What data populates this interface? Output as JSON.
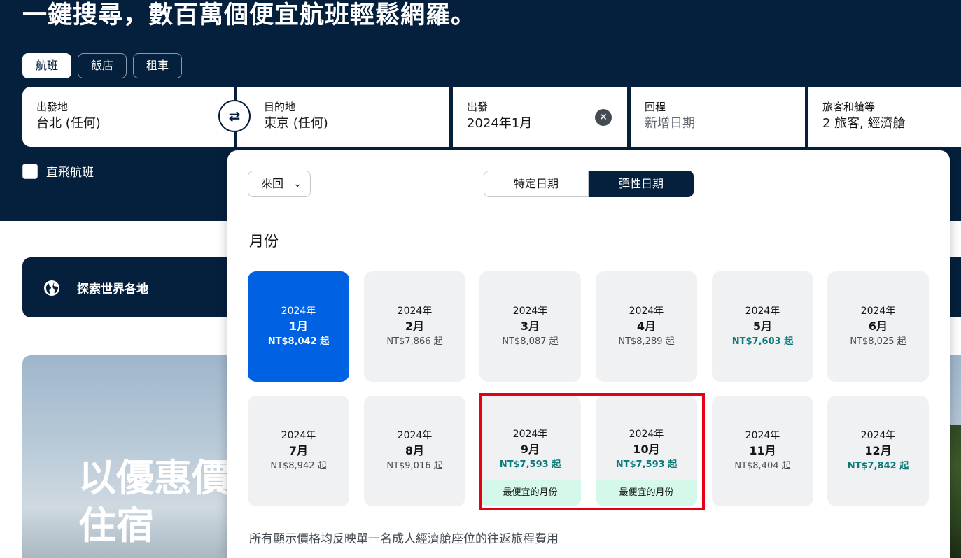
{
  "headline": "一鍵搜尋，數百萬個便宜航班輕鬆網羅。",
  "tabs": [
    {
      "label": "航班",
      "active": true
    },
    {
      "label": "飯店",
      "active": false
    },
    {
      "label": "租車",
      "active": false
    }
  ],
  "search": {
    "origin": {
      "label": "出發地",
      "value": "台北 (任何)"
    },
    "swap_icon": "⇄",
    "destination": {
      "label": "目的地",
      "value": "東京 (任何)"
    },
    "depart": {
      "label": "出發",
      "value": "2024年1月",
      "clear_icon": "✕"
    },
    "return": {
      "label": "回程",
      "placeholder": "新增日期"
    },
    "travellers": {
      "label": "旅客和艙等",
      "value": "2 旅客, 經濟艙"
    }
  },
  "direct_flights_label": "直飛航班",
  "explore_label": "探索世界各地",
  "promo_text": [
    "以優惠價",
    "住宿"
  ],
  "picker": {
    "trip_type": "來回",
    "trip_type_chevron": "⌄",
    "mode_specific": "特定日期",
    "mode_flexible": "彈性日期",
    "month_heading": "月份",
    "footnote": "所有顯示價格均反映單一名成人經濟艙座位的往返旅程費用",
    "months": [
      {
        "year": "2024年",
        "month": "1月",
        "price": "NT$8,042 起",
        "selected": true,
        "cheap": false
      },
      {
        "year": "2024年",
        "month": "2月",
        "price": "NT$7,866 起",
        "selected": false,
        "cheap": false
      },
      {
        "year": "2024年",
        "month": "3月",
        "price": "NT$8,087 起",
        "selected": false,
        "cheap": false
      },
      {
        "year": "2024年",
        "month": "4月",
        "price": "NT$8,289 起",
        "selected": false,
        "cheap": false
      },
      {
        "year": "2024年",
        "month": "5月",
        "price": "NT$7,603 起",
        "selected": false,
        "cheap": true
      },
      {
        "year": "2024年",
        "month": "6月",
        "price": "NT$8,025 起",
        "selected": false,
        "cheap": false
      },
      {
        "year": "2024年",
        "month": "7月",
        "price": "NT$8,942 起",
        "selected": false,
        "cheap": false
      },
      {
        "year": "2024年",
        "month": "8月",
        "price": "NT$9,016 起",
        "selected": false,
        "cheap": false
      },
      {
        "year": "2024年",
        "month": "9月",
        "price": "NT$7,593 起",
        "selected": false,
        "cheap": true,
        "badge": "最便宜的月份"
      },
      {
        "year": "2024年",
        "month": "10月",
        "price": "NT$7,593 起",
        "selected": false,
        "cheap": true,
        "badge": "最便宜的月份"
      },
      {
        "year": "2024年",
        "month": "11月",
        "price": "NT$8,404 起",
        "selected": false,
        "cheap": false
      },
      {
        "year": "2024年",
        "month": "12月",
        "price": "NT$7,842 起",
        "selected": false,
        "cheap": true
      }
    ]
  },
  "colors": {
    "navy": "#05203c",
    "selected_blue": "#0062e3",
    "cheap_teal": "#0a7a7a",
    "badge_mint": "#d4f8ea",
    "highlight_red": "#e60012"
  }
}
